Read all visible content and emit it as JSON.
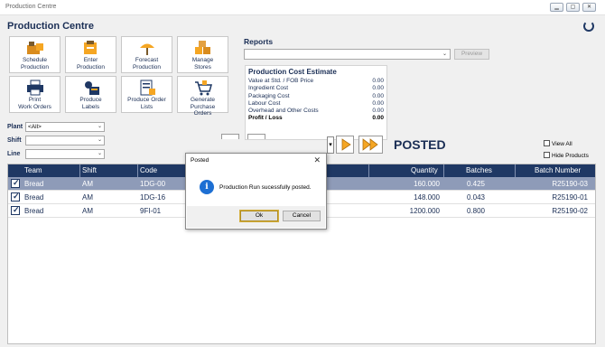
{
  "window": {
    "title": "Production Centre",
    "controls": [
      "minimize",
      "restore",
      "close"
    ]
  },
  "app": {
    "heading": "Production Centre"
  },
  "tiles": [
    {
      "label": "Schedule\nProduction",
      "icon": "schedule-production-icon"
    },
    {
      "label": "Enter\nProduction",
      "icon": "enter-production-icon"
    },
    {
      "label": "Forecast\nProduction",
      "icon": "forecast-production-icon"
    },
    {
      "label": "Manage\nStores",
      "icon": "manage-stores-icon"
    },
    {
      "label": "Print\nWork Orders",
      "icon": "printer-icon"
    },
    {
      "label": "Produce\nLabels",
      "icon": "labels-icon"
    },
    {
      "label": "Produce Order\nLists",
      "icon": "order-lists-icon"
    },
    {
      "label": "Generate Purchase\nOrders",
      "icon": "cart-icon"
    }
  ],
  "filters": {
    "plant_label": "Plant",
    "plant_value": "<All>",
    "shift_label": "Shift",
    "shift_value": "",
    "line_label": "Line",
    "line_value": ""
  },
  "reports": {
    "label": "Reports",
    "selected": "",
    "preview_label": "Preview"
  },
  "cost_estimate": {
    "title": "Production Cost Estimate",
    "rows": [
      {
        "label": "Value at Std. / FOB Price",
        "value": "0.00"
      },
      {
        "label": "Ingredient Cost",
        "value": "0.00"
      },
      {
        "label": "Packaging Cost",
        "value": "0.00"
      },
      {
        "label": "Labour Cost",
        "value": "0.00"
      },
      {
        "label": "Overhead and Other Costs",
        "value": "0.00"
      },
      {
        "label": "Profit / Loss",
        "value": "0.00"
      }
    ]
  },
  "status": {
    "posted_label": "POSTED"
  },
  "options": {
    "view_all": "View All",
    "hide_products": "Hide Products"
  },
  "grid": {
    "columns": [
      "Team",
      "Shift",
      "Code",
      "Quantity",
      "Batches",
      "Batch Number"
    ],
    "rows": [
      {
        "team": "Bread",
        "shift": "AM",
        "code": "1DG-00",
        "quantity": "160.000",
        "batches": "0.425",
        "batch_number": "R25190-03",
        "selected": true
      },
      {
        "team": "Bread",
        "shift": "AM",
        "code": "1DG-16",
        "quantity": "148.000",
        "batches": "0.043",
        "batch_number": "R25190-01",
        "selected": false
      },
      {
        "team": "Bread",
        "shift": "AM",
        "code": "9FI-01",
        "quantity": "1200.000",
        "batches": "0.800",
        "batch_number": "R25190-02",
        "selected": false
      }
    ]
  },
  "dialog": {
    "title": "Posted",
    "message": "Production Run sucessfully posted.",
    "ok_label": "Ok",
    "cancel_label": "Cancel"
  },
  "colors": {
    "navy": "#1f3864",
    "selection": "#8e9bb8",
    "accent_orange": "#f5a623",
    "info_blue": "#1d6fd3"
  }
}
